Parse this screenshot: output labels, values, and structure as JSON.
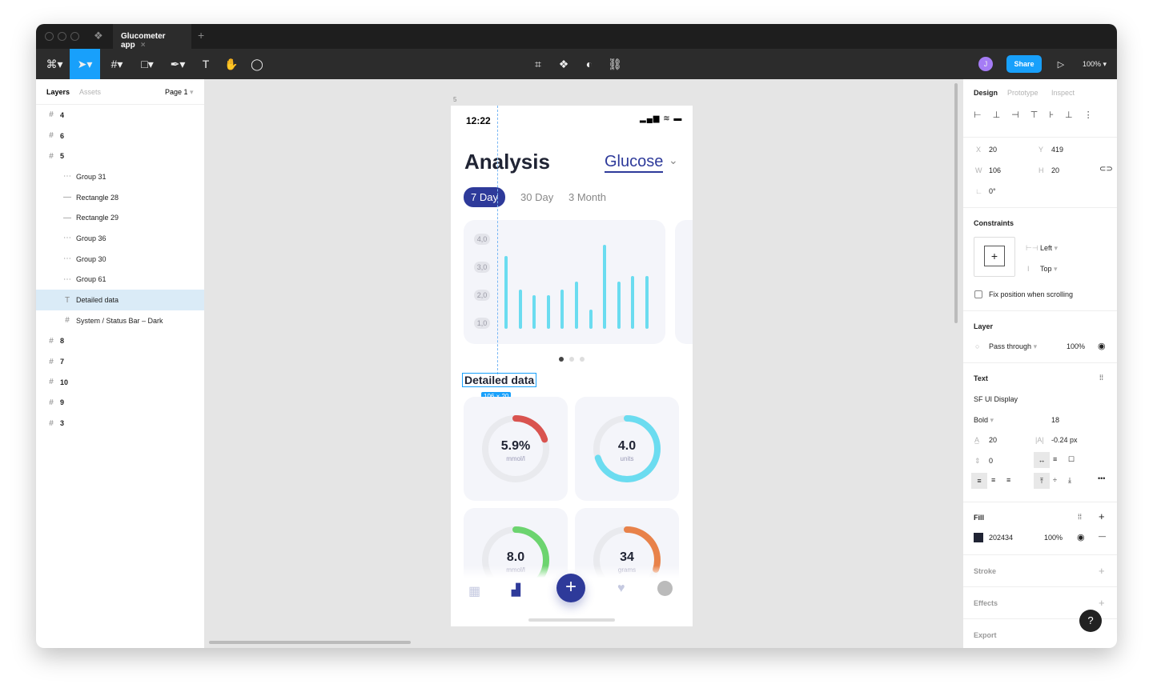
{
  "tab": {
    "title": "Glucometer app"
  },
  "toolbar": {
    "share": "Share",
    "zoom": "100%",
    "avatar": "J"
  },
  "left": {
    "tabs": [
      "Layers",
      "Assets"
    ],
    "page": "Page 1",
    "layers": [
      {
        "label": "4",
        "kind": "frame",
        "indent": 0
      },
      {
        "label": "6",
        "kind": "frame",
        "indent": 0
      },
      {
        "label": "5",
        "kind": "frame",
        "indent": 0
      },
      {
        "label": "Group 31",
        "kind": "group",
        "indent": 1
      },
      {
        "label": "Rectangle 28",
        "kind": "rect",
        "indent": 1
      },
      {
        "label": "Rectangle 29",
        "kind": "rect",
        "indent": 1
      },
      {
        "label": "Group 36",
        "kind": "group",
        "indent": 1
      },
      {
        "label": "Group 30",
        "kind": "group",
        "indent": 1
      },
      {
        "label": "Group 61",
        "kind": "group",
        "indent": 1
      },
      {
        "label": "Detailed data",
        "kind": "text",
        "indent": 1,
        "selected": true
      },
      {
        "label": "System / Status Bar – Dark",
        "kind": "component",
        "indent": 1
      },
      {
        "label": "8",
        "kind": "frame",
        "indent": 0
      },
      {
        "label": "7",
        "kind": "frame",
        "indent": 0
      },
      {
        "label": "10",
        "kind": "frame",
        "indent": 0
      },
      {
        "label": "9",
        "kind": "frame",
        "indent": 0
      },
      {
        "label": "3",
        "kind": "frame",
        "indent": 0
      }
    ]
  },
  "canvas": {
    "frame_label": "5",
    "size_badge": "106 × 20"
  },
  "phone": {
    "time": "12:22",
    "title": "Analysis",
    "metric": "Glucose",
    "ranges": [
      "7 Day",
      "30 Day",
      "3 Month"
    ],
    "y_ticks": [
      "4,0",
      "3,0",
      "2,0",
      "1,0"
    ],
    "bars": [
      3.4,
      2.2,
      2.0,
      2.0,
      2.2,
      2.5,
      1.5,
      3.8,
      2.5,
      2.7,
      2.7
    ],
    "section": "Detailed data",
    "cards": [
      {
        "value": "5.9%",
        "unit": "mmol/l",
        "color": "#d9534f",
        "fraction": 0.2
      },
      {
        "value": "4.0",
        "unit": "units",
        "color": "#6bdcf0",
        "fraction": 0.7
      },
      {
        "value": "8.0",
        "unit": "mmol/l",
        "color": "#6cd46f",
        "fraction": 0.55
      },
      {
        "value": "34",
        "unit": "grams",
        "color": "#e8824a",
        "fraction": 0.3
      }
    ]
  },
  "design": {
    "tabs": [
      "Design",
      "Prototype",
      "Inspect"
    ],
    "x": "20",
    "y": "419",
    "w": "106",
    "h": "20",
    "rotation": "0°",
    "constraints_title": "Constraints",
    "h_constraint": "Left",
    "v_constraint": "Top",
    "fix_position": "Fix position when scrolling",
    "layer_title": "Layer",
    "blend": "Pass through",
    "opacity": "100%",
    "text_title": "Text",
    "font": "SF UI Display",
    "weight": "Bold",
    "size": "18",
    "line_height": "20",
    "letter_spacing": "-0.24 px",
    "para_spacing": "0",
    "fill_title": "Fill",
    "fill_hex": "202434",
    "fill_color": "#202434",
    "fill_opacity": "100%",
    "stroke": "Stroke",
    "effects": "Effects",
    "export": "Export",
    "help": "?"
  },
  "colors": {
    "accent": "#18a0fb",
    "brand": "#2e3a9a"
  }
}
